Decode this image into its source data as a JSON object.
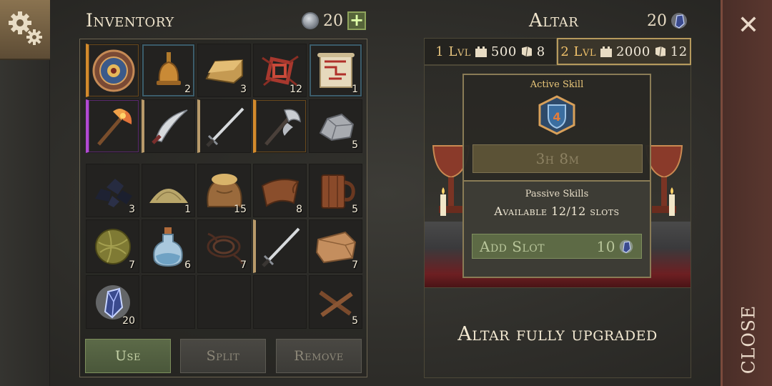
{
  "inventory": {
    "title": "Inventory",
    "gem_count": "20",
    "top_slots": [
      {
        "name": "round-shield",
        "count": "",
        "rarity": "orange"
      },
      {
        "name": "bronze-bell",
        "count": "2",
        "rarity": "teal"
      },
      {
        "name": "gold-ingot",
        "count": "3",
        "rarity": ""
      },
      {
        "name": "red-rune-knot",
        "count": "12",
        "rarity": ""
      },
      {
        "name": "treasure-map-scroll",
        "count": "1",
        "rarity": "teal"
      },
      {
        "name": "fire-axe",
        "count": "",
        "rarity": "purple"
      },
      {
        "name": "curved-scimitar",
        "count": "",
        "rarity": "tan"
      },
      {
        "name": "long-sword",
        "count": "",
        "rarity": "tan"
      },
      {
        "name": "battle-axe",
        "count": "",
        "rarity": "orange"
      },
      {
        "name": "iron-ore",
        "count": "5",
        "rarity": ""
      }
    ],
    "bottom_slots": [
      {
        "name": "coal",
        "count": "3"
      },
      {
        "name": "sand-pile",
        "count": "1"
      },
      {
        "name": "grain-sack",
        "count": "15"
      },
      {
        "name": "leather-hide",
        "count": "8"
      },
      {
        "name": "wooden-mug",
        "count": "5"
      },
      {
        "name": "fiber-ball",
        "count": "7"
      },
      {
        "name": "potion-bottle",
        "count": "6"
      },
      {
        "name": "rope-coil",
        "count": "7"
      },
      {
        "name": "steel-sword",
        "count": ""
      },
      {
        "name": "folded-cloth",
        "count": "7"
      },
      {
        "name": "soul-crystal",
        "count": "20"
      },
      {
        "name": "empty",
        "count": ""
      },
      {
        "name": "empty",
        "count": ""
      },
      {
        "name": "empty",
        "count": ""
      },
      {
        "name": "wooden-sticks",
        "count": "5"
      }
    ],
    "buttons": {
      "use": "Use",
      "split": "Split",
      "remove": "Remove"
    }
  },
  "altar": {
    "title": "Altar",
    "shard_count": "20",
    "tabs": [
      {
        "level": "1 Lvl",
        "cost1": "500",
        "cost2": "8"
      },
      {
        "level": "2 Lvl",
        "cost1": "2000",
        "cost2": "12"
      }
    ],
    "active_skill_label": "Active Skill",
    "skill_level": "4",
    "timer": "3h 8m",
    "passive_label": "Passive Skills",
    "slots_text": "Available 12/12 slots",
    "add_slot_label": "Add Slot",
    "add_slot_cost": "10",
    "upgrade_text": "Altar fully upgraded"
  },
  "close_label": "CLOSE",
  "colors": {
    "accent_gold": "#e6c47f",
    "active_green": "#5d6a45",
    "rarity_orange": "#d38a2c",
    "rarity_purple": "#b24ad3"
  }
}
